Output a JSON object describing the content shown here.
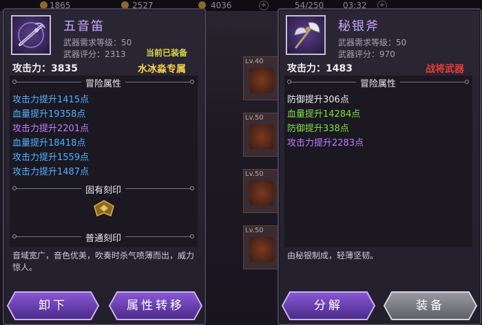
{
  "topbar": {
    "res1": "1865",
    "res2": "2527",
    "res3": "4036",
    "stamina": "54/250",
    "time": "03:32"
  },
  "slots": [
    {
      "level": "Lv.40"
    },
    {
      "level": "Lv.50"
    },
    {
      "level": "Lv.50"
    },
    {
      "level": "Lv.50"
    }
  ],
  "left": {
    "name": "五音笛",
    "req_label": "武器需求等级",
    "req_value": "50",
    "score_label": "武器评分",
    "score_value": "2313",
    "status": "当前已装备",
    "atk_label": "攻击力",
    "atk_value": "3835",
    "exclusive": "水冰淼专属",
    "adv_title": "冒险属性",
    "stats": [
      {
        "text": "攻击力提升1415点",
        "color": "blue"
      },
      {
        "text": "血量提升19358点",
        "color": "blue"
      },
      {
        "text": "攻击力提升2201点",
        "color": "purple"
      },
      {
        "text": "血量提升18418点",
        "color": "blue"
      },
      {
        "text": "攻击力提升1559点",
        "color": "blue"
      },
      {
        "text": "攻击力提升1487点",
        "color": "blue"
      }
    ],
    "inherent_title": "固有刻印",
    "normal_title": "普通刻印",
    "description": "音域宽广，音色优美，吹奏时杀气喷薄而出，威力惊人。",
    "btn_unequip": "卸下",
    "btn_transfer": "属性转移"
  },
  "right": {
    "name": "秘银斧",
    "req_label": "武器需求等级",
    "req_value": "50",
    "score_label": "武器评分",
    "score_value": "970",
    "atk_label": "攻击力",
    "atk_value": "1483",
    "exclusive": "战将武器",
    "adv_title": "冒险属性",
    "stats": [
      {
        "text": "防御提升306点",
        "color": "white"
      },
      {
        "text": "血量提升14284点",
        "color": "green"
      },
      {
        "text": "防御提升338点",
        "color": "green"
      },
      {
        "text": "攻击力提升2283点",
        "color": "purple"
      }
    ],
    "description": "由秘银制成，轻薄坚韧。",
    "btn_decompose": "分解",
    "btn_equip": "装备"
  }
}
